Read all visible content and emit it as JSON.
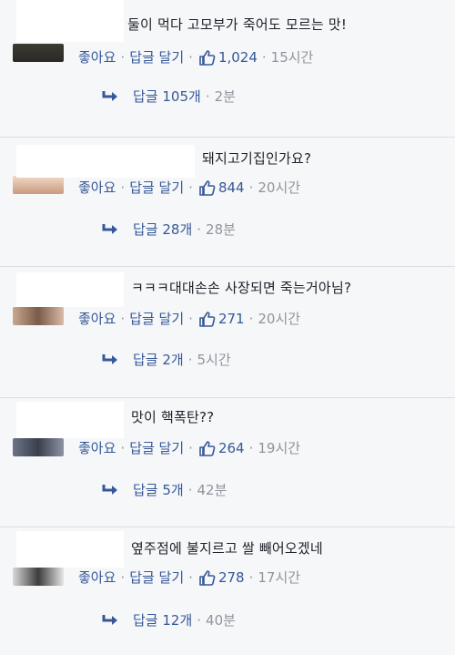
{
  "comments": [
    {
      "text": "둘이 먹다 고모부가 죽어도 모르는 맛!",
      "like_label": "좋아요",
      "reply_label": "답글 달기",
      "likes": "1,024",
      "time": "15시간",
      "replies_label": "답글 105개",
      "replies_time": "2분"
    },
    {
      "text": "돼지고기집인가요?",
      "like_label": "좋아요",
      "reply_label": "답글 달기",
      "likes": "844",
      "time": "20시간",
      "replies_label": "답글 28개",
      "replies_time": "28분"
    },
    {
      "text": "ㅋㅋㅋ대대손손 사장되면 죽는거아님?",
      "like_label": "좋아요",
      "reply_label": "답글 달기",
      "likes": "271",
      "time": "20시간",
      "replies_label": "답글 2개",
      "replies_time": "5시간"
    },
    {
      "text": "맛이 핵폭탄??",
      "like_label": "좋아요",
      "reply_label": "답글 달기",
      "likes": "264",
      "time": "19시간",
      "replies_label": "답글 5개",
      "replies_time": "42분"
    },
    {
      "text": "옆주점에 불지르고 쌀 빼어오겠네",
      "like_label": "좋아요",
      "reply_label": "답글 달기",
      "likes": "278",
      "time": "17시간",
      "replies_label": "답글 12개",
      "replies_time": "40분"
    }
  ],
  "separator": "·",
  "colors": {
    "link": "#365899",
    "meta": "#90949c",
    "background": "#f6f7f9"
  }
}
